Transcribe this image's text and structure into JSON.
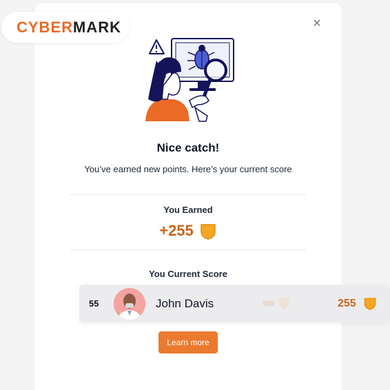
{
  "brand": {
    "part_a": "CYBER",
    "part_b": "MARK",
    "color_a": "#ea6a26",
    "color_b": "#1f1f1f"
  },
  "modal": {
    "close_icon": "×",
    "title": "Nice catch!",
    "subtitle": "You’ve earned new points. Here’s your current score",
    "earned_label": "You Earned",
    "earned_value": "+255",
    "score_label": "You Current Score"
  },
  "leaderboard_row": {
    "rank": "55",
    "name": "John Davis",
    "score": "255"
  },
  "actions": {
    "learn_more": "Learn more"
  },
  "colors": {
    "accent": "#eb7a2f",
    "points": "#c8641c",
    "coin": "#f5a623",
    "illustration_navy": "#14145a",
    "illustration_blue": "#4b5fd6"
  },
  "icons": {
    "close": "close-icon",
    "coin": "shield-coin-icon",
    "warning": "warning-icon",
    "bug": "bug-icon",
    "magnifier": "magnifier-icon"
  }
}
